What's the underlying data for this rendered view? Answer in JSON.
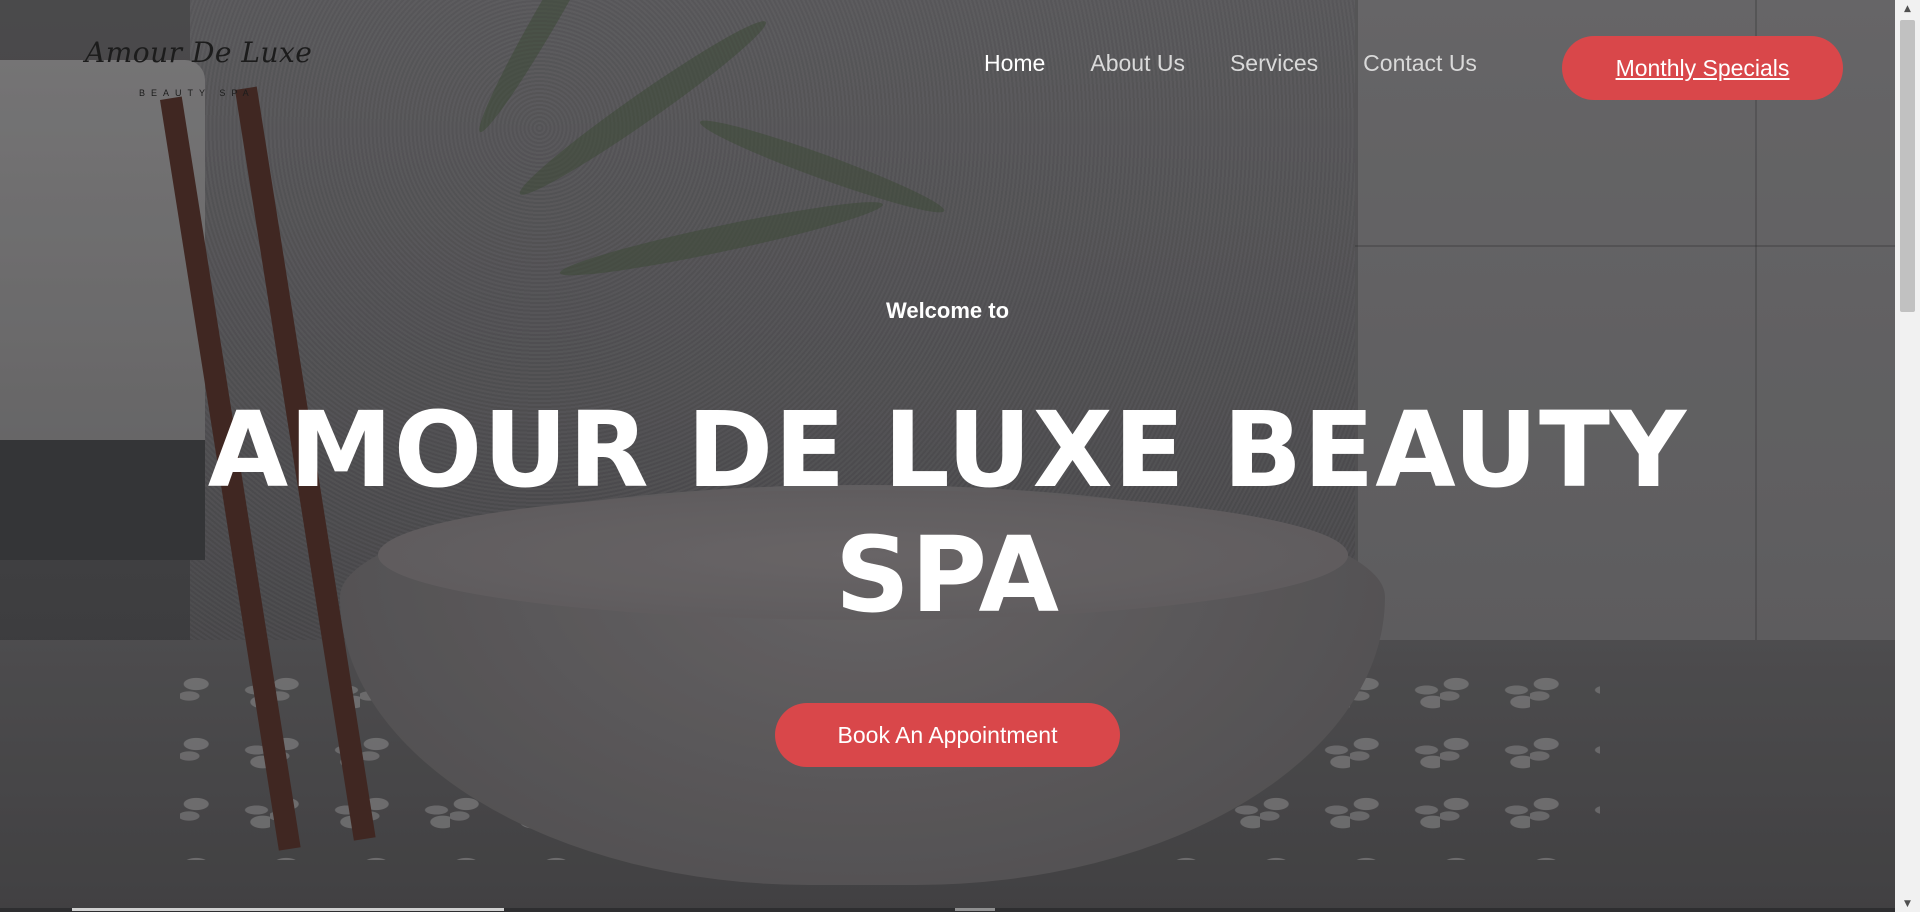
{
  "brand": {
    "logo_main": "Amour   De Luxe",
    "logo_sub": "BEAUTY SPA"
  },
  "nav": {
    "items": [
      {
        "label": "Home",
        "active": true
      },
      {
        "label": "About Us",
        "active": false
      },
      {
        "label": "Services",
        "active": false
      },
      {
        "label": "Contact Us",
        "active": false
      }
    ],
    "cta_label": "Monthly Specials"
  },
  "hero": {
    "welcome": "Welcome to",
    "title_line1": "AMOUR DE LUXE BEAUTY",
    "title_line2": "SPA",
    "button_label": "Book An Appointment"
  },
  "colors": {
    "accent": "#d9474a",
    "nav_text": "#d9d9d9",
    "nav_active": "#ffffff"
  },
  "icons": {
    "scroll_up": "chevron-up-icon",
    "scroll_down": "chevron-down-icon"
  }
}
